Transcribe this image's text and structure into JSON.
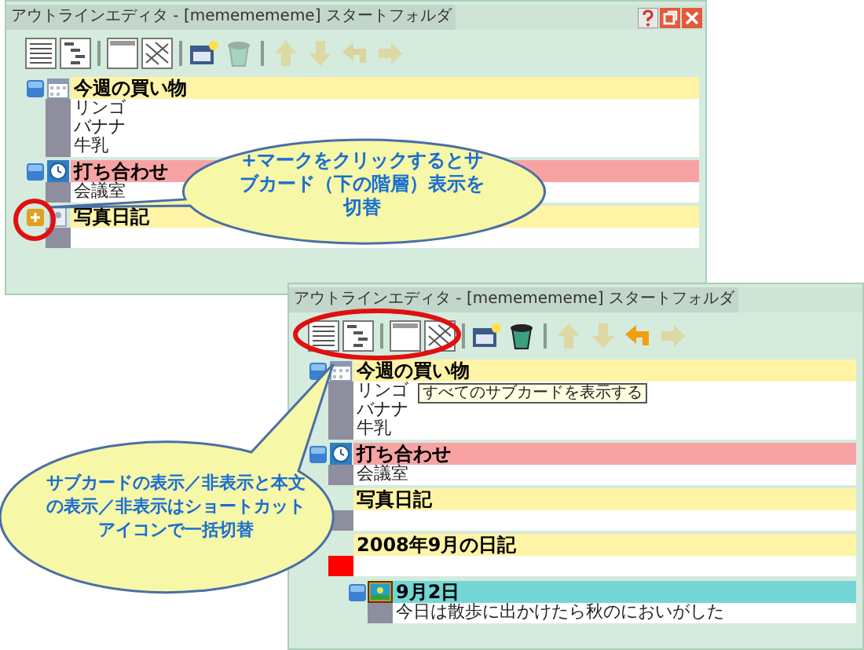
{
  "windows": [
    {
      "title": "アウトラインエディタ - [mememememe] スタートフォルダ",
      "window_buttons": true,
      "toolbar": [
        {
          "kind": "list",
          "disabled": false
        },
        {
          "kind": "tree",
          "disabled": false
        },
        {
          "kind": "blank",
          "disabled": false
        },
        {
          "kind": "hatched",
          "disabled": false
        },
        {
          "kind": "new",
          "disabled": false
        },
        {
          "kind": "trash",
          "disabled": true
        },
        {
          "kind": "up",
          "disabled": true
        },
        {
          "kind": "down",
          "disabled": true
        },
        {
          "kind": "left",
          "disabled": true
        },
        {
          "kind": "right",
          "disabled": true
        }
      ],
      "cards": [
        {
          "title": "今週の買い物",
          "color": "#fff3a6",
          "collapsed": false,
          "kind": "calendar",
          "lines": [
            "リンゴ",
            "バナナ",
            "牛乳"
          ]
        },
        {
          "title": "打ち合わせ",
          "color": "#f7a3a3",
          "collapsed": false,
          "kind": "clock",
          "lines": [
            "会議室"
          ]
        },
        {
          "title": "写真日記",
          "color": "#fff3a6",
          "collapsed": true,
          "kind": "photo"
        }
      ]
    },
    {
      "title": "アウトラインエディタ - [mememememe] スタートフォルダ",
      "window_buttons": false,
      "toolbar": [
        {
          "kind": "list",
          "disabled": false
        },
        {
          "kind": "tree",
          "disabled": false
        },
        {
          "kind": "blank",
          "disabled": false
        },
        {
          "kind": "hatched",
          "disabled": false
        },
        {
          "kind": "new",
          "disabled": false
        },
        {
          "kind": "trash",
          "disabled": false
        },
        {
          "kind": "up",
          "disabled": true
        },
        {
          "kind": "down",
          "disabled": true
        },
        {
          "kind": "left",
          "disabled": false
        },
        {
          "kind": "right",
          "disabled": true
        }
      ],
      "tooltip": "すべてのサブカードを表示する",
      "cards": [
        {
          "title": "今週の買い物",
          "color": "#fff3a6",
          "collapsed": false,
          "kind": "calendar",
          "lines": [
            "リンゴ",
            "バナナ",
            "牛乳"
          ]
        },
        {
          "title": "打ち合わせ",
          "color": "#f7a3a3",
          "collapsed": false,
          "kind": "clock",
          "lines": [
            "会議室"
          ]
        },
        {
          "title": "写真日記",
          "color": "#fff3a6"
        },
        {
          "title": "2008年9月の日記",
          "color": "#fff3a6",
          "strip": {
            "color": "#ff0000"
          },
          "children": [
            {
              "title": "9月2日",
              "color": "#74d6d6",
              "collapsed": false,
              "kind": "picture",
              "lines": [
                "今日は散歩に出かけたら秋のにおいがした"
              ]
            }
          ]
        }
      ]
    }
  ],
  "callouts": [
    "+マークをクリックするとサブカード（下の階層）表示を切替",
    "サブカードの表示／非表示と本文の表示／非表示はショートカットアイコンで一括切替"
  ]
}
